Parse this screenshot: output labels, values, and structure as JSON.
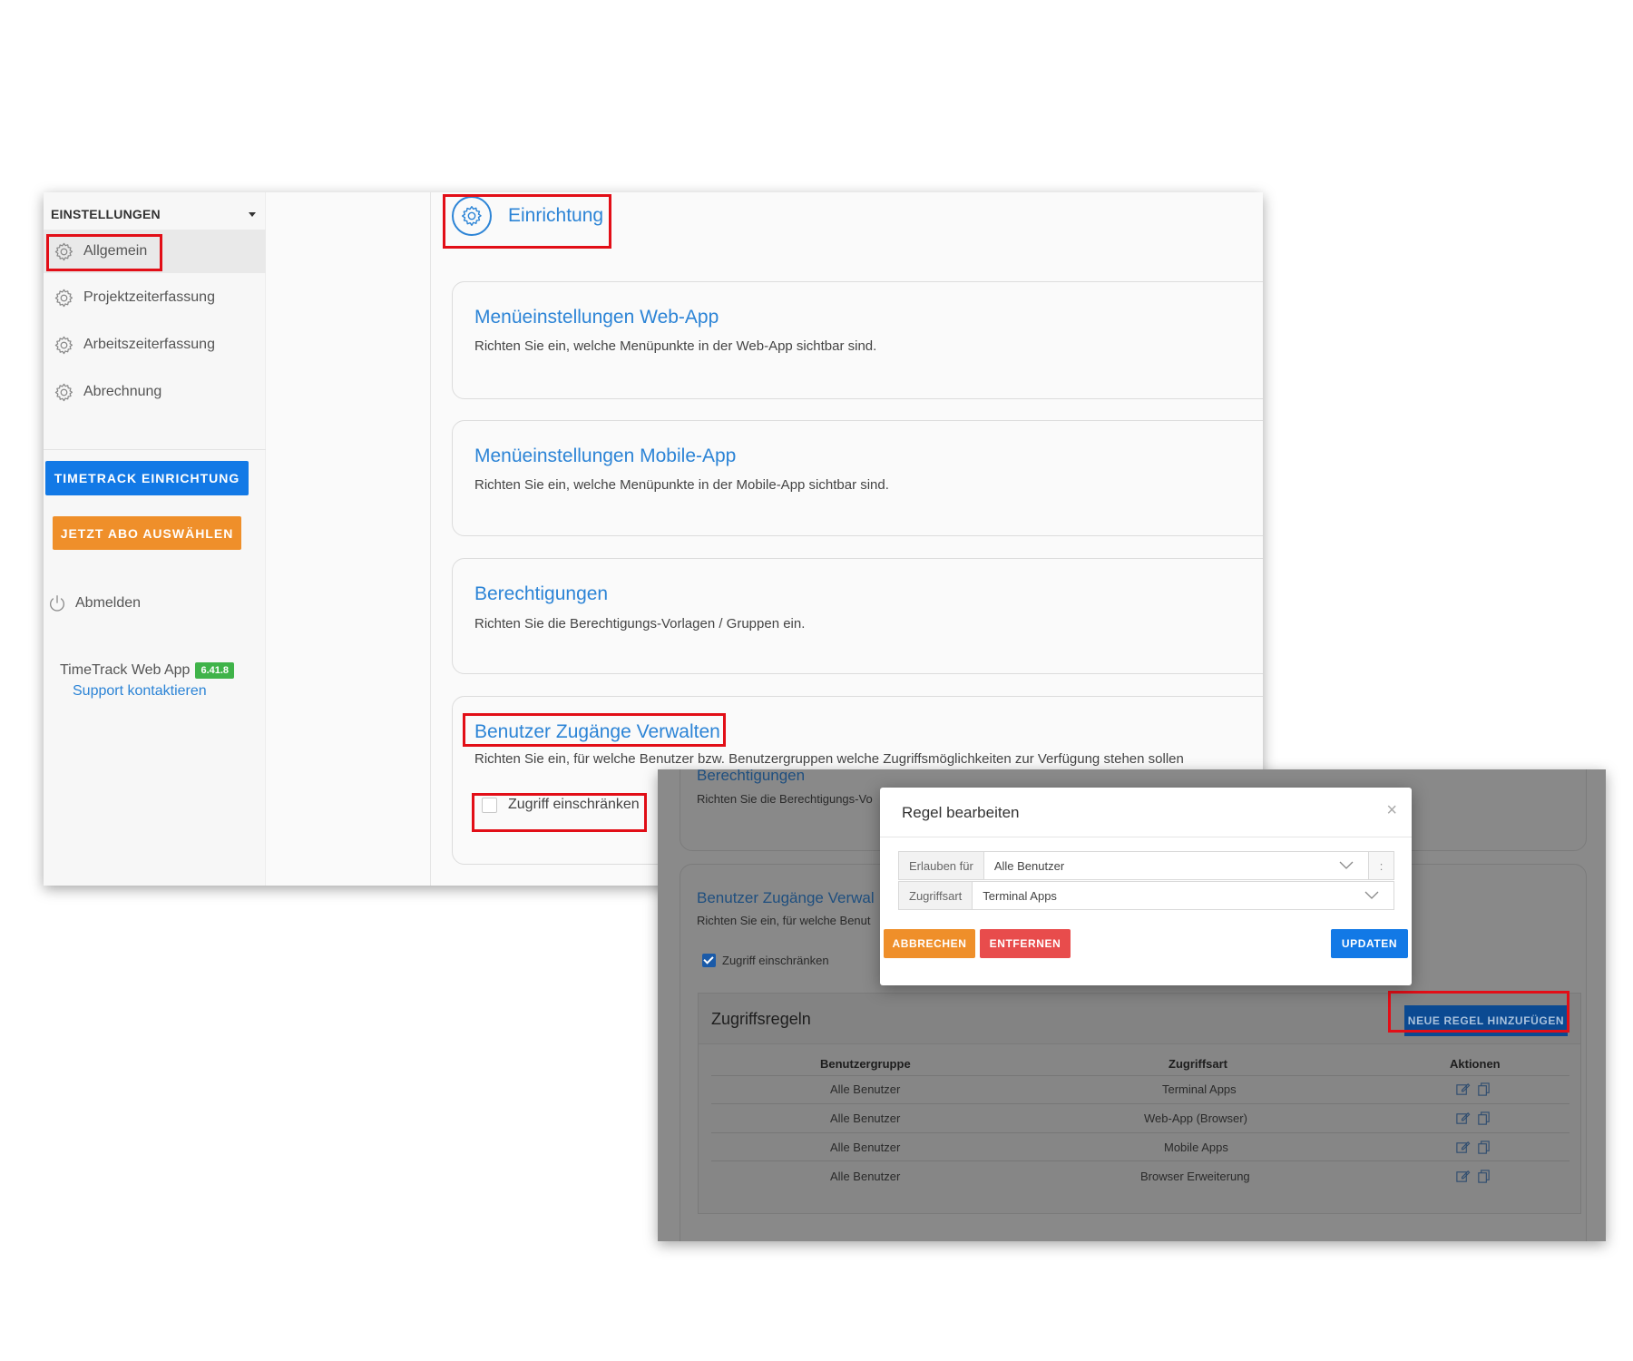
{
  "sidebar": {
    "header": "EINSTELLUNGEN",
    "items": [
      {
        "label": "Allgemein",
        "icon": "gear-icon",
        "active": true
      },
      {
        "label": "Projektzeiterfassung",
        "icon": "gear-icon",
        "active": false
      },
      {
        "label": "Arbeitszeiterfassung",
        "icon": "gear-icon",
        "active": false
      },
      {
        "label": "Abrechnung",
        "icon": "gear-icon",
        "active": false
      }
    ],
    "setup_button": "TIMETRACK EINRICHTUNG",
    "subscribe_button": "JETZT ABO AUSWÄHLEN",
    "logout": "Abmelden",
    "app_name": "TimeTrack Web App",
    "version": "6.41.8",
    "support_link": "Support kontaktieren"
  },
  "main": {
    "title": "Einrichtung",
    "cards": [
      {
        "title": "Menüeinstellungen Web-App",
        "desc": "Richten Sie ein, welche Menüpunkte in der Web-App sichtbar sind."
      },
      {
        "title": "Menüeinstellungen Mobile-App",
        "desc": "Richten Sie ein, welche Menüpunkte in der Mobile-App sichtbar sind."
      },
      {
        "title": "Berechtigungen",
        "desc": "Richten Sie die Berechtigungs-Vorlagen / Gruppen ein."
      },
      {
        "title": "Benutzer Zugänge Verwalten",
        "desc": "Richten Sie ein, für welche Benutzer bzw. Benutzergruppen welche Zugriffsmöglichkeiten zur Verfügung stehen sollen",
        "checkbox": "Zugriff einschränken",
        "checked": false
      }
    ]
  },
  "overlay": {
    "bg_card1_title": "Berechtigungen",
    "bg_card1_desc": "Richten Sie die Berechtigungs-Vo",
    "bg_card2_title": "Benutzer Zugänge Verwal",
    "bg_card2_desc": "Richten Sie ein, für welche Benut",
    "checkbox": "Zugriff einschränken",
    "checked": true,
    "rules_title": "Zugriffsregeln",
    "new_rule_button": "NEUE REGEL HINZUFÜGEN",
    "table": {
      "headers": [
        "Benutzergruppe",
        "Zugriffsart",
        "Aktionen"
      ],
      "rows": [
        [
          "Alle Benutzer",
          "Terminal Apps"
        ],
        [
          "Alle Benutzer",
          "Web-App (Browser)"
        ],
        [
          "Alle Benutzer",
          "Mobile Apps"
        ],
        [
          "Alle Benutzer",
          "Browser Erweiterung"
        ]
      ]
    },
    "modal": {
      "title": "Regel bearbeiten",
      "close": "×",
      "field1_label": "Erlauben für",
      "field1_value": "Alle Benutzer",
      "field1_extra": ":",
      "field2_label": "Zugriffsart",
      "field2_value": "Terminal Apps",
      "cancel": "ABBRECHEN",
      "remove": "ENTFERNEN",
      "update": "UPDATEN"
    }
  },
  "colors": {
    "primary_blue": "#1279e6",
    "link_blue": "#2c84d6",
    "orange": "#ef8f2a",
    "red": "#e84c4c",
    "highlight_red": "#e20e17",
    "badge_green": "#3fb349"
  }
}
